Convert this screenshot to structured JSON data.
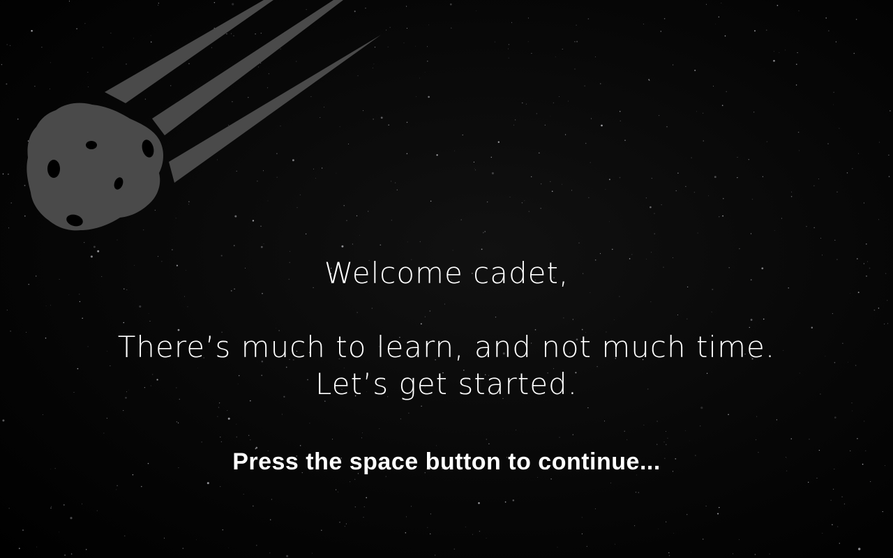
{
  "scene": {
    "background_color": "#000000",
    "star_color": "#e8e8ee",
    "meteor_color": "#4a4a4a",
    "meteor_crater_color": "#000000"
  },
  "intro": {
    "greeting": "Welcome cadet,",
    "line_1": "There’s much to learn, and not much time.",
    "line_2": "Let’s get started.",
    "continue_prompt": "Press the space button to continue..."
  }
}
